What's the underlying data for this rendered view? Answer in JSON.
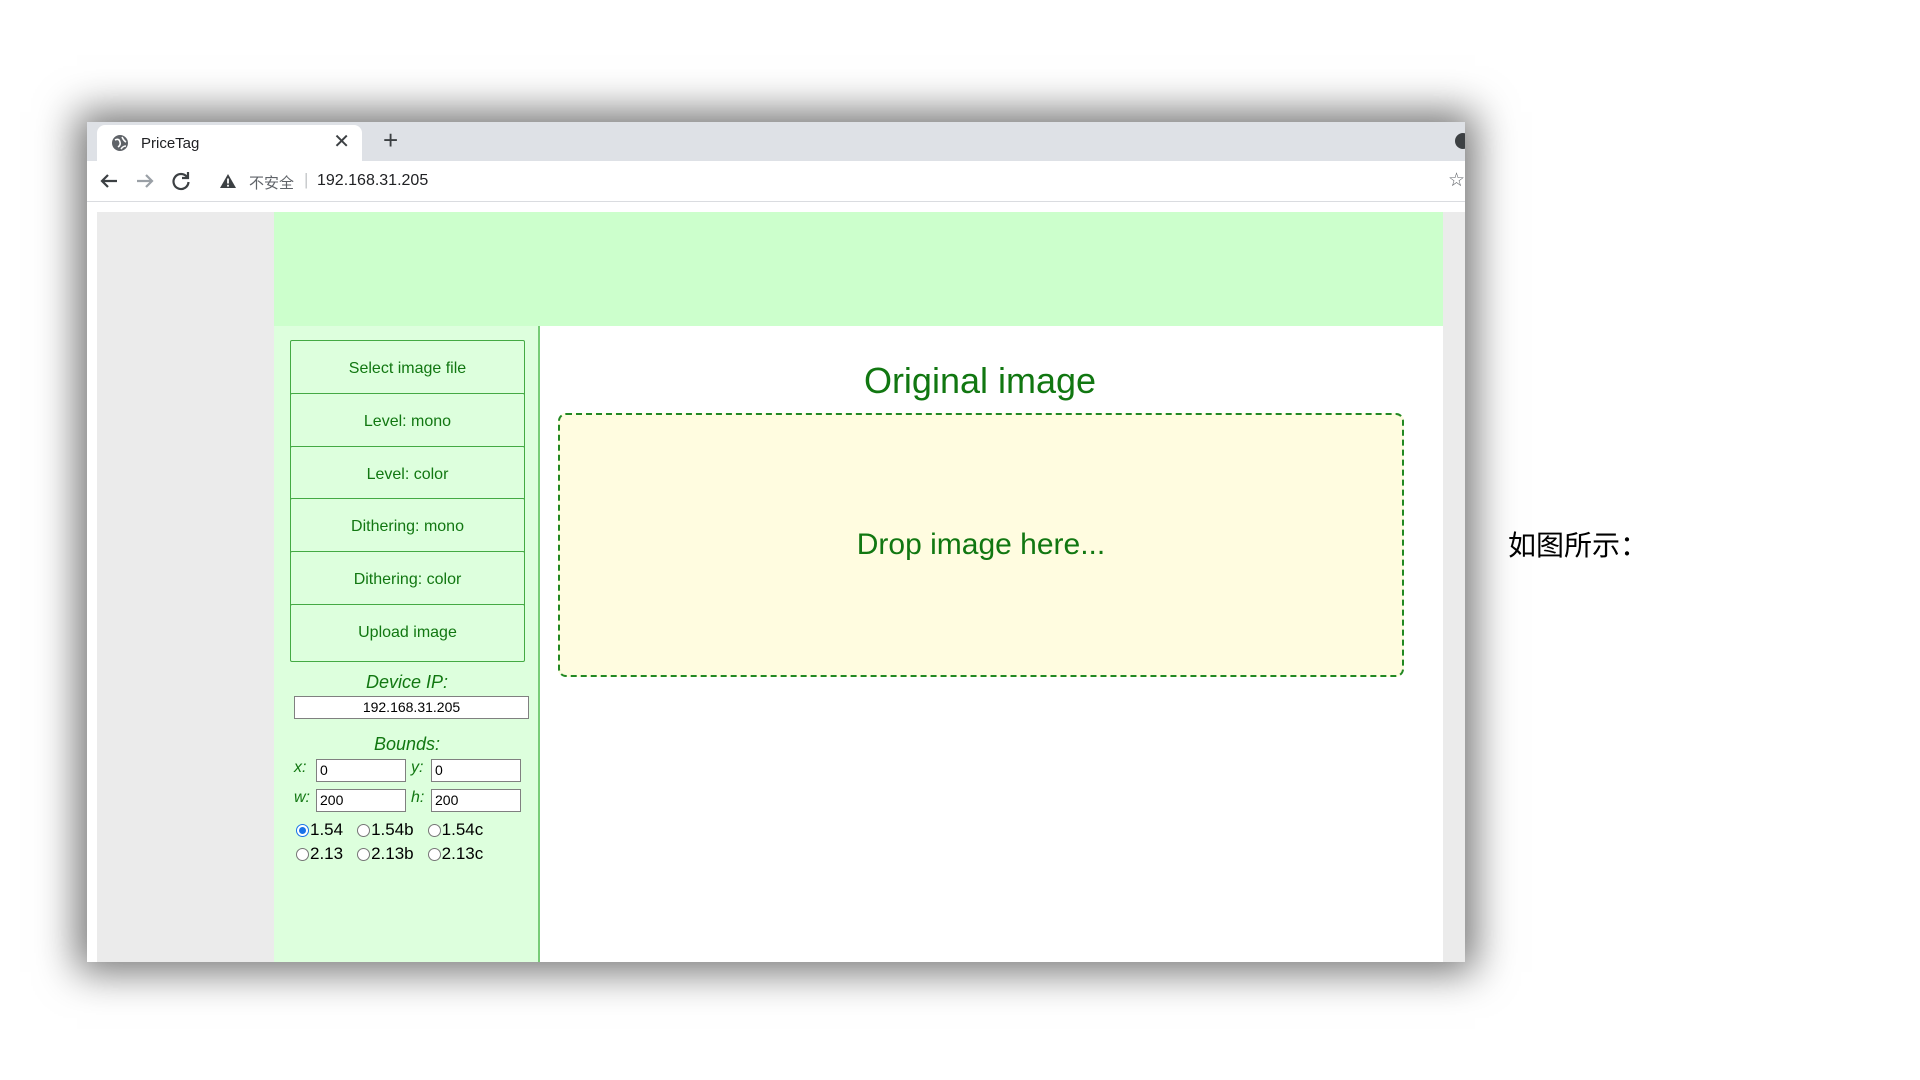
{
  "browser": {
    "tab_title": "PriceTag",
    "tab_close": "✕",
    "new_tab": "+",
    "not_secure": "不安全",
    "url_separator": "|",
    "url": "192.168.31.205",
    "bookmark_star": "☆"
  },
  "sidebar": {
    "buttons": [
      {
        "label": "Select image file"
      },
      {
        "label": "Level: mono"
      },
      {
        "label": "Level: color"
      },
      {
        "label": "Dithering: mono"
      },
      {
        "label": "Dithering: color"
      },
      {
        "label": "Upload image"
      }
    ],
    "device_ip_label": "Device IP:",
    "device_ip_value": "192.168.31.205",
    "bounds_label": "Bounds:",
    "bounds": {
      "x_label": "x:",
      "x_value": "0",
      "y_label": "y:",
      "y_value": "0",
      "w_label": "w:",
      "w_value": "200",
      "h_label": "h:",
      "h_value": "200"
    },
    "display_sizes": [
      {
        "label": "1.54",
        "checked": true
      },
      {
        "label": "1.54b",
        "checked": false
      },
      {
        "label": "1.54c",
        "checked": false
      },
      {
        "label": "2.13",
        "checked": false
      },
      {
        "label": "2.13b",
        "checked": false
      },
      {
        "label": "2.13c",
        "checked": false
      }
    ]
  },
  "main": {
    "title": "Original image",
    "dropzone_text": "Drop image here..."
  },
  "annotation": "如图所示："
}
